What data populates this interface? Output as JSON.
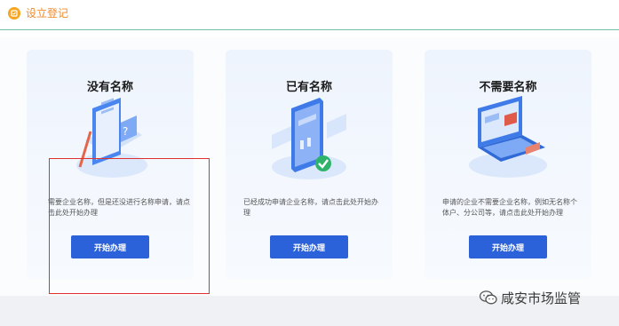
{
  "header": {
    "title": "设立登记",
    "icon": "clipboard-icon",
    "accent_color": "#f5a623"
  },
  "cards": [
    {
      "title": "没有名称",
      "description": "需要企业名称，但是还没进行名称申请，请点击此处开始办理",
      "button_label": "开始办理",
      "illustration": "document-form-illustration"
    },
    {
      "title": "已有名称",
      "description": "已经成功申请企业名称，请点击此处开始办理",
      "button_label": "开始办理",
      "illustration": "phone-checkmark-illustration"
    },
    {
      "title": "不需要名称",
      "description": "申请的企业不需要企业名称，例如无名称个体户、分公司等，请点击此处开始办理",
      "button_label": "开始办理",
      "illustration": "laptop-illustration"
    }
  ],
  "watermark": {
    "text": "咸安市场监管",
    "icon": "wechat-icon"
  },
  "colors": {
    "button": "#2b62d9",
    "highlight": "#e0312f",
    "header_line": "#39a57e"
  }
}
